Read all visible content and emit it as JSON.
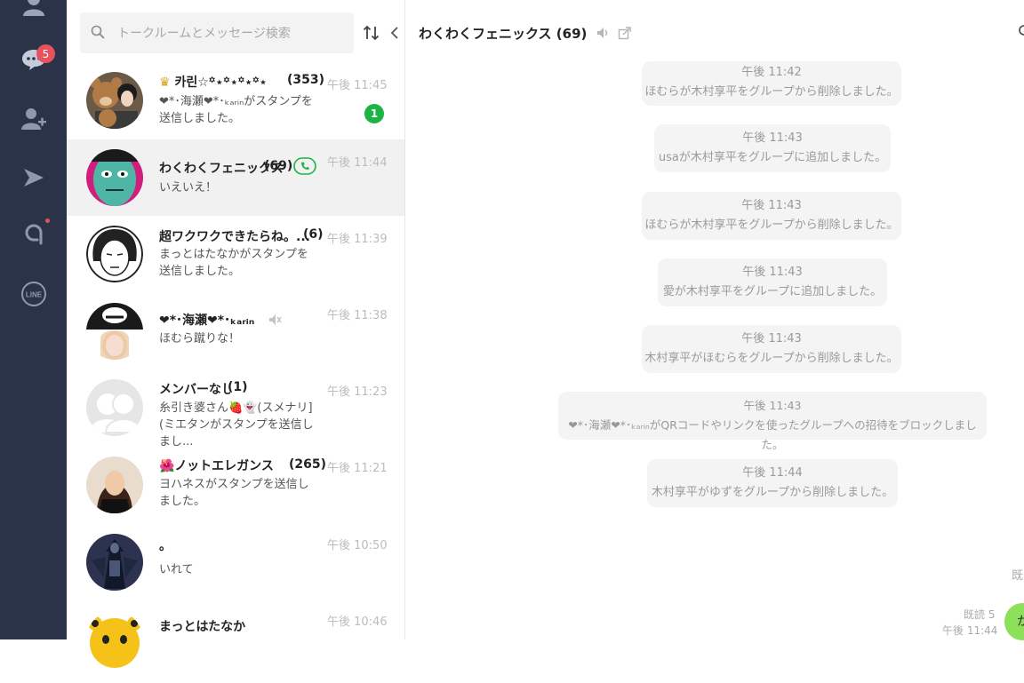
{
  "nav": {
    "badge": "5",
    "line_label": "LINE"
  },
  "search": {
    "placeholder": "トークルームとメッセージ検索"
  },
  "chats": [
    {
      "name": "카린☆꙳⋆꙳⋆꙳⋆꙳⋆",
      "count": "(353)",
      "time": "午後 11:45",
      "preview": "❤︎*･海瀬❤︎*･ₖₐᵣᵢₙがスタンプを送信しました。",
      "unread": "1"
    },
    {
      "name": "わくわくフェニックス",
      "count": "(69)",
      "time": "午後 11:44",
      "preview": "いえいえ！"
    },
    {
      "name": "超ワクワクできたらね。...",
      "count": "(6)",
      "time": "午後 11:39",
      "preview": "まっとはたなかがスタンプを送信しました。"
    },
    {
      "name": "❤︎*･海瀬❤︎*･ₖₐᵣᵢₙ",
      "count": "",
      "time": "午後 11:38",
      "preview": "ほむら蹴りな！"
    },
    {
      "name": "メンバーなし",
      "count": "(1)",
      "time": "午後 11:23",
      "preview": "糸引き婆さん🍓👻(スメナリ](ミエタンがスタンプを送信しまし..."
    },
    {
      "name": "🌺ノットエレガンス...",
      "count": "(265)",
      "time": "午後 11:21",
      "preview": "ヨハネスがスタンプを送信しました。"
    },
    {
      "name": "。",
      "count": "",
      "time": "午後 10:50",
      "preview": "いれて"
    },
    {
      "name": "まっとはたなか",
      "count": "",
      "time": "午後 10:46",
      "preview": ""
    }
  ],
  "conversation": {
    "title": "わくわくフェニックス (69)",
    "messages": [
      {
        "time": "午後 11:42",
        "text": "ほむらが木村享平をグループから削除しました。"
      },
      {
        "time": "午後 11:43",
        "text": "usaが木村享平をグループに追加しました。"
      },
      {
        "time": "午後 11:43",
        "text": "ほむらが木村享平をグループから削除しました。"
      },
      {
        "time": "午後 11:43",
        "text": "愛が木村享平をグループに追加しました。"
      },
      {
        "time": "午後 11:43",
        "text": "木村享平がほむらをグループから削除しました。"
      },
      {
        "time": "午後 11:43",
        "text": "❤︎*･海瀬❤︎*･ₖₐᵣᵢₙがQRコードやリンクを使ったグループへの招待をブロックしました。"
      },
      {
        "time": "午後 11:44",
        "text": "木村享平がゆずをグループから削除しました。"
      }
    ],
    "read_right": "既",
    "read_bottom": "既読 5",
    "time_bottom": "午後 11:44",
    "bubble_text": "か"
  },
  "colors": {
    "nav_bg": "#2b3348",
    "badge": "#e8525f",
    "unread": "#1db446",
    "call_icon": "#1db446"
  }
}
